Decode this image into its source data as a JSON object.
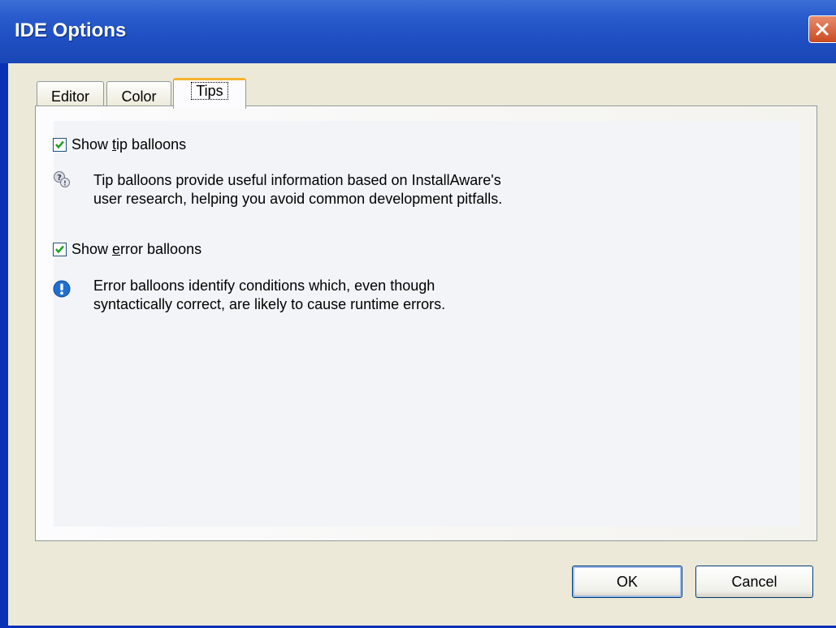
{
  "window": {
    "title": "IDE Options",
    "close_icon": "close-icon"
  },
  "tabs": [
    {
      "label": "Editor",
      "active": false
    },
    {
      "label": "Color",
      "active": false
    },
    {
      "label": "Tips",
      "active": true
    }
  ],
  "tips_panel": {
    "tip_balloons": {
      "label_before": "Show ",
      "label_accel": "t",
      "label_after": "ip balloons",
      "checked": true,
      "icon": "help-tip-icon",
      "description_line1": "Tip balloons provide useful information based on InstallAware's",
      "description_line2": "user research, helping you avoid common development pitfalls."
    },
    "error_balloons": {
      "label_before": "Show ",
      "label_accel": "e",
      "label_after": "rror balloons",
      "checked": true,
      "icon": "info-exclamation-icon",
      "description_line1": "Error balloons identify conditions which, even though",
      "description_line2": "syntactically correct, are likely to cause runtime errors."
    }
  },
  "buttons": {
    "ok_label": "OK",
    "cancel_label": "Cancel"
  },
  "colors": {
    "titlebar": "#2a5ccd",
    "accent_tab": "#f7b32f",
    "check_green": "#21a121",
    "info_blue": "#1f6fd0"
  }
}
